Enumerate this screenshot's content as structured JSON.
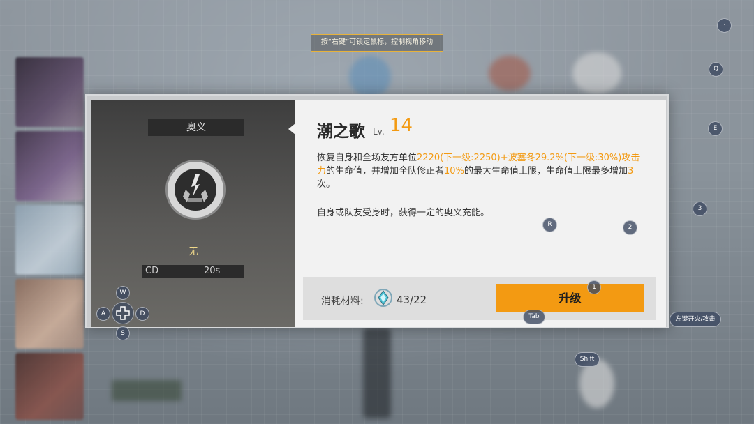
{
  "tip": {
    "text": "按“右键”可锁定鼠标，控制视角移动"
  },
  "skill": {
    "section_title": "奥义",
    "equip_status": "无",
    "cd_label": "CD",
    "cd_value": "20s",
    "name": "潮之歌",
    "level_label": "Lv.",
    "level": "14",
    "desc_parts": [
      {
        "text": "恢复自身和全场友方单位",
        "highlight": false
      },
      {
        "text": "2220(下一级:2250)+波塞冬29.2%(下一级:30%)攻击力",
        "highlight": true
      },
      {
        "text": "的生命值，并增加全队修正者",
        "highlight": false
      },
      {
        "text": "10%",
        "highlight": true
      },
      {
        "text": "的最大生命值上限，生命值上限最多增加",
        "highlight": false
      },
      {
        "text": "3",
        "highlight": true
      },
      {
        "text": "次。",
        "highlight": false
      }
    ],
    "desc2": "自身或队友受身时，获得一定的奥义充能。",
    "cost_label": "消耗材料:",
    "cost_value": "43/22",
    "upgrade_label": "升级"
  },
  "keys": {
    "top_dot": "·",
    "q": "Q",
    "e": "E",
    "three": "3",
    "r": "R",
    "two": "2",
    "one": "1",
    "tab": "Tab",
    "shift": "Shift",
    "fire": "左键开火/攻击",
    "w": "W",
    "a": "A",
    "s": "S",
    "d": "D"
  },
  "colors": {
    "accent": "#f39a12",
    "tip_border": "#e7b23b"
  }
}
